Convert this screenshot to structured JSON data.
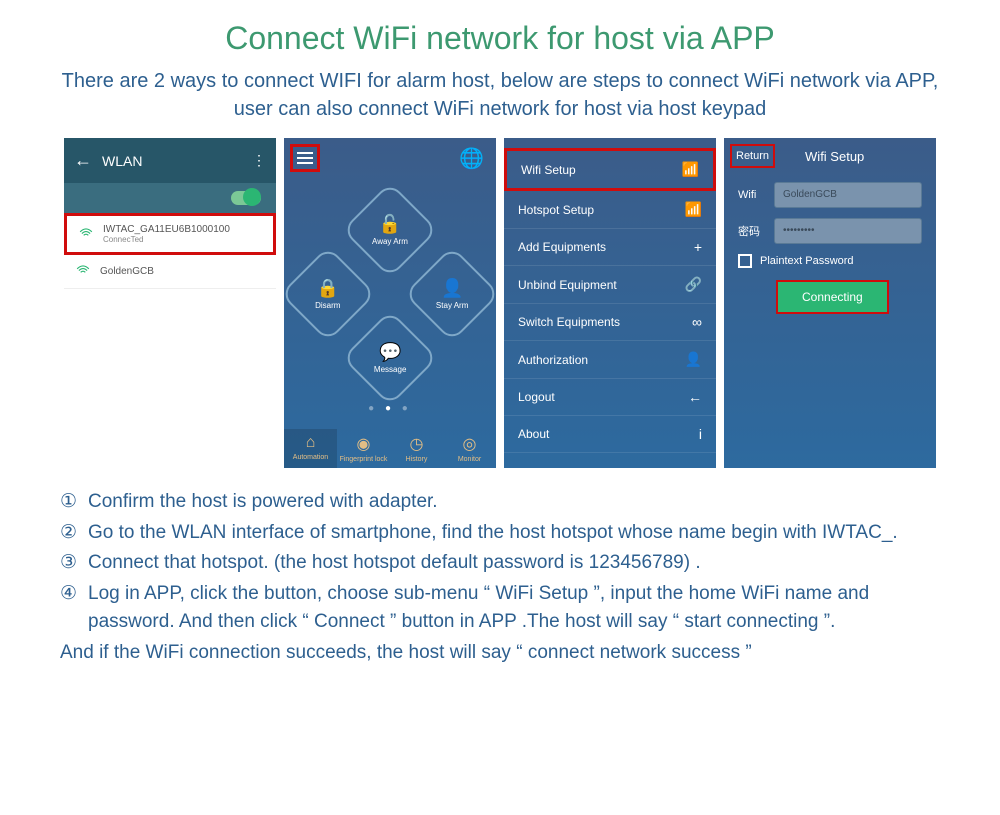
{
  "title": "Connect WiFi network for host via APP",
  "subtitle": "There are 2 ways to connect WIFI for alarm host, below are steps to connect WiFi network via APP, user can also connect WiFi network for host via host keypad",
  "screen1": {
    "header": "WLAN",
    "wifi1_name": "IWTAC_GA11EU6B1000100",
    "wifi1_status": "ConnecTed",
    "wifi2_name": "GoldenGCB"
  },
  "screen2": {
    "btn_top": "Away Arm",
    "btn_left": "Disarm",
    "btn_right": "Stay Arm",
    "btn_bottom": "Message",
    "nav1": "Automation",
    "nav2": "Fingerprint lock",
    "nav3": "History",
    "nav4": "Monitor"
  },
  "screen3": {
    "items": [
      {
        "label": "Wifi Setup",
        "icon": "wifi"
      },
      {
        "label": "Hotspot Setup",
        "icon": "wifi"
      },
      {
        "label": "Add Equipments",
        "icon": "plus"
      },
      {
        "label": "Unbind Equipment",
        "icon": "link"
      },
      {
        "label": "Switch Equipments",
        "icon": "switch"
      },
      {
        "label": "Authorization",
        "icon": "user"
      },
      {
        "label": "Logout",
        "icon": "arrow"
      },
      {
        "label": "About",
        "icon": "info"
      }
    ]
  },
  "screen4": {
    "return": "Return",
    "title": "Wifi Setup",
    "wifi_label": "Wifi",
    "wifi_value": "GoldenGCB",
    "pwd_label": "密码",
    "pwd_value": "•••••••••",
    "plaintext": "Plaintext Password",
    "connect": "Connecting"
  },
  "instructions": {
    "n1": "①",
    "t1": "Confirm the host is powered with adapter.",
    "n2": "②",
    "t2": "Go to the WLAN interface of smartphone, find the host hotspot whose name begin with IWTAC_.",
    "n3": "③",
    "t3": "Connect that hotspot. (the host hotspot default password is 123456789) .",
    "n4": "④",
    "t4": "Log in APP, click the      button, choose sub-menu “ WiFi Setup ”, input the home WiFi name and password. And then click “ Connect ” button in APP .The host will say “ start connecting ”.",
    "final": "And if the WiFi connection succeeds, the host will say “ connect network success ”"
  }
}
